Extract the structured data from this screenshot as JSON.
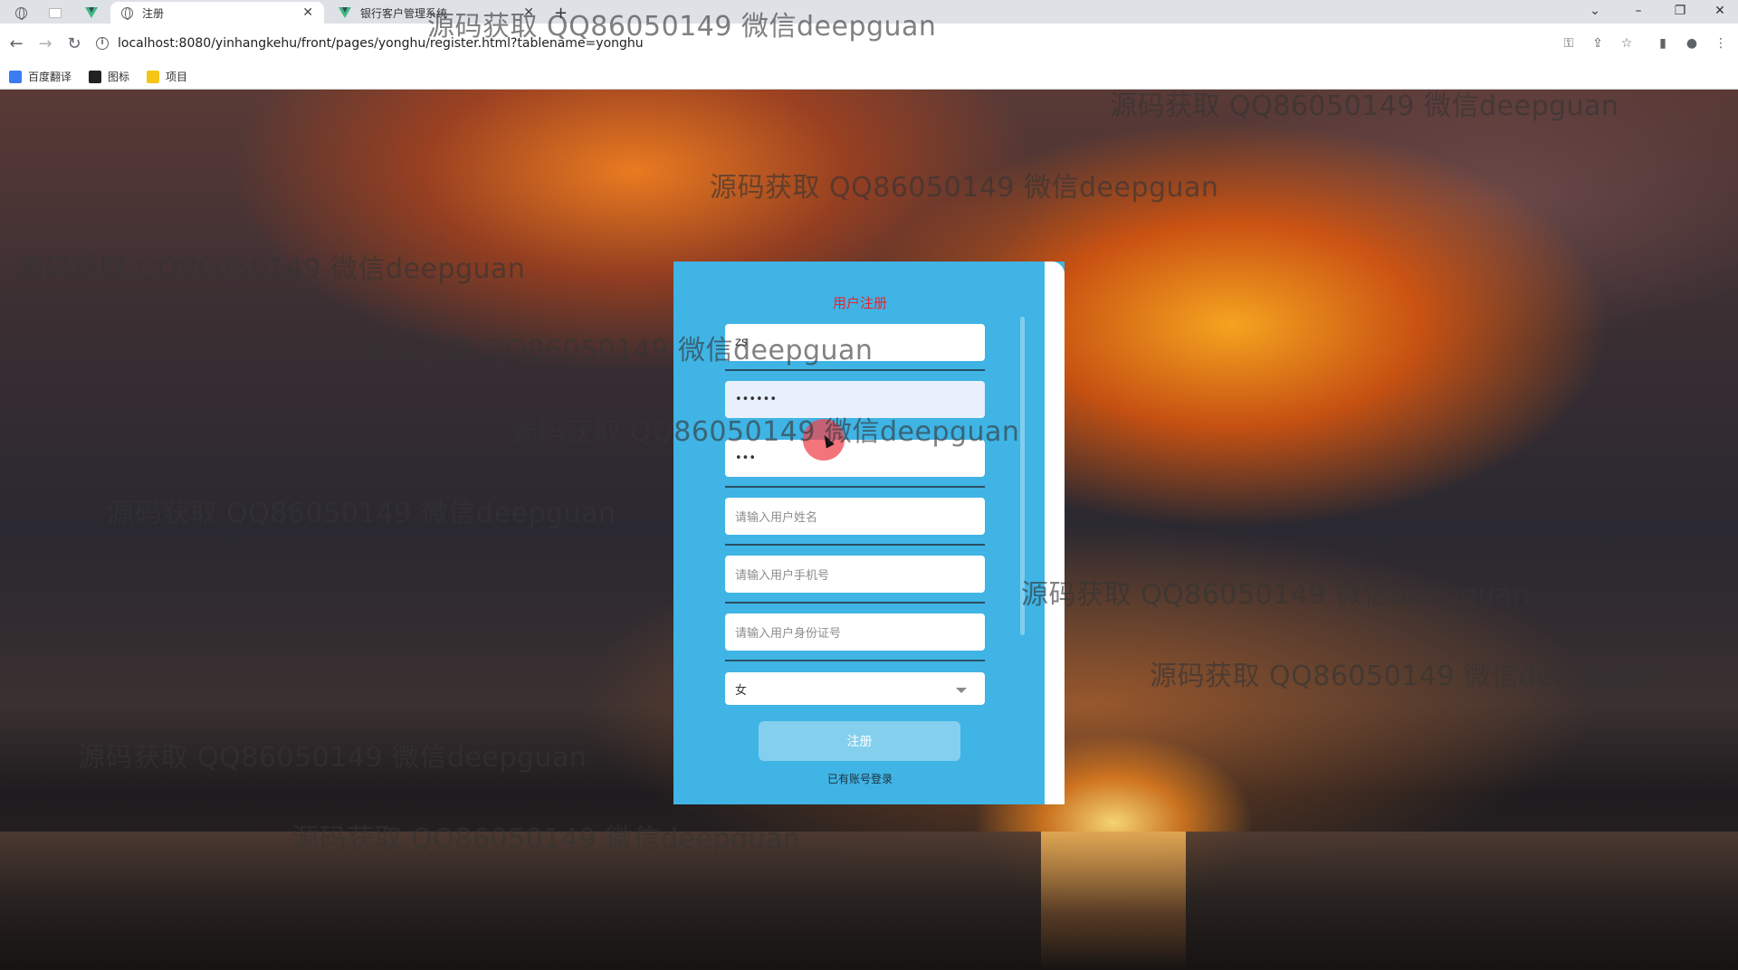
{
  "browser": {
    "tabs": [
      {
        "title": "注册",
        "active": true,
        "icon": "globe-icon"
      },
      {
        "title": "银行客户管理系统",
        "active": false,
        "icon": "vue-icon"
      }
    ],
    "pinned_icons": [
      "globe-icon",
      "blank-page-icon",
      "vue-icon"
    ],
    "new_tab_glyph": "+",
    "url": "localhost:8080/yinhangkehu/front/pages/yonghu/register.html?tablename=yonghu",
    "bookmarks": [
      {
        "label": "百度翻译",
        "icon": "translate-icon",
        "color": "#3a7cf3"
      },
      {
        "label": "图标",
        "icon": "image-icon",
        "color": "#222222"
      },
      {
        "label": "项目",
        "icon": "folder-icon",
        "color": "#f5c518"
      }
    ],
    "window_controls": {
      "dropdown": "⌄",
      "minimize": "–",
      "restore": "❐",
      "close": "✕"
    }
  },
  "watermark_text": "源码获取 QQ86050149 微信deepguan",
  "form": {
    "title": "用户注册",
    "fields": [
      {
        "name": "account",
        "value": "zs",
        "placeholder": ""
      },
      {
        "name": "password",
        "value": "••••••",
        "placeholder": ""
      },
      {
        "name": "confirm-password",
        "value": "•••",
        "placeholder": ""
      },
      {
        "name": "real-name",
        "value": "",
        "placeholder": "请输入用户姓名"
      },
      {
        "name": "phone",
        "value": "",
        "placeholder": "请输入用户手机号"
      },
      {
        "name": "id-card",
        "value": "",
        "placeholder": "请输入用户身份证号"
      }
    ],
    "gender_selected": "女",
    "submit_label": "注册",
    "login_link": "已有账号登录"
  },
  "colors": {
    "card": "#3fb4e5",
    "title": "#e8232f",
    "submit": "#84cfee"
  }
}
